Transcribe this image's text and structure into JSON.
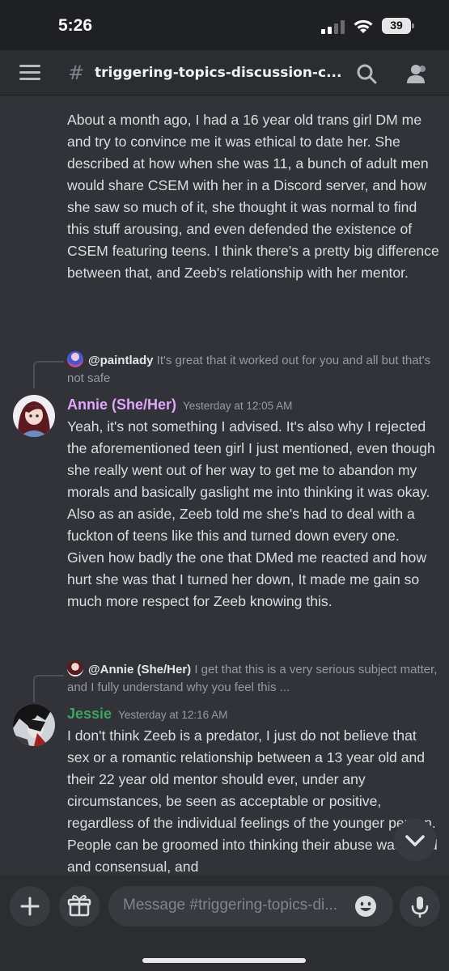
{
  "status_bar": {
    "time": "5:26",
    "battery": "39"
  },
  "header": {
    "channel_name": "triggering-topics-discussion-c..."
  },
  "messages": {
    "m0_text": "About a month ago, I had a 16 year old trans girl DM me and try to convince me it was ethical to date her. She described at how when she was 11, a bunch of adult men would share CSEM with her in a Discord server, and how she saw so much of it, she thought it was normal to find this stuff arousing, and even defended the existence of CSEM featuring teens. I think there's a pretty big difference between that, and Zeeb's relationship with her mentor.",
    "m1": {
      "reply_user": "@paintlady",
      "reply_text": "It's great that it worked out for you and all but that's not safe",
      "author": "Annie (She/Her)",
      "author_color": "#e3a6ff",
      "timestamp": "Yesterday at 12:05 AM",
      "text": "Yeah, it's not something I advised. It's also why I rejected the aforementioned teen girl I just mentioned, even though she really went out of her way to get me to abandon my morals and basically gaslight me into thinking it was okay. Also as an aside, Zeeb told me she's had to deal with a fuckton of teens like this and turned down every one. Given how badly the one that DMed me reacted and how hurt she was that I turned her down, It made me gain so much more respect for Zeeb knowing this."
    },
    "m2": {
      "reply_user": "@Annie (She/Her)",
      "reply_text": "I get that this is a very serious subject matter, and I fully understand why you feel this ...",
      "author": "Jessie",
      "author_color": "#3ba55c",
      "timestamp": "Yesterday at 12:16 AM",
      "text": "I don't think Zeeb is a predator, I just do not believe that sex or a romantic relationship between a 13 year old and their 22 year old mentor should ever, under any circumstances, be seen as acceptable or positive, regardless of the individual feelings of the younger person. People can be groomed into thinking their abuse was good and consensual, and"
    }
  },
  "composer": {
    "placeholder": "Message #triggering-topics-di..."
  },
  "colors": {
    "background": "#313338",
    "header": "#2b2d31",
    "status_bar": "#1f2024"
  }
}
